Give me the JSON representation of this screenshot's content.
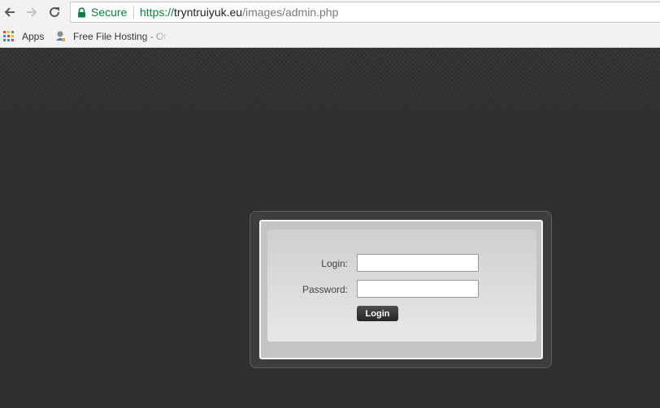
{
  "browser": {
    "secure_label": "Secure",
    "url_scheme": "https://",
    "url_host": "tryntruiyuk.eu",
    "url_path": "/images/admin.php",
    "icons": [
      "back-icon",
      "forward-icon",
      "reload-icon",
      "lock-icon"
    ]
  },
  "bookmarks": [
    {
      "label": "Apps",
      "icon": "apps-grid-icon"
    },
    {
      "label": "Free File Hosting - Or",
      "icon": "file-hosting-icon"
    }
  ],
  "login_form": {
    "login_label": "Login:",
    "login_value": "",
    "password_label": "Password:",
    "password_value": "",
    "submit_label": "Login"
  },
  "colors": {
    "page_background": "#2f2f2f",
    "secure_green": "#0b8043",
    "button_dark": "#333333"
  }
}
